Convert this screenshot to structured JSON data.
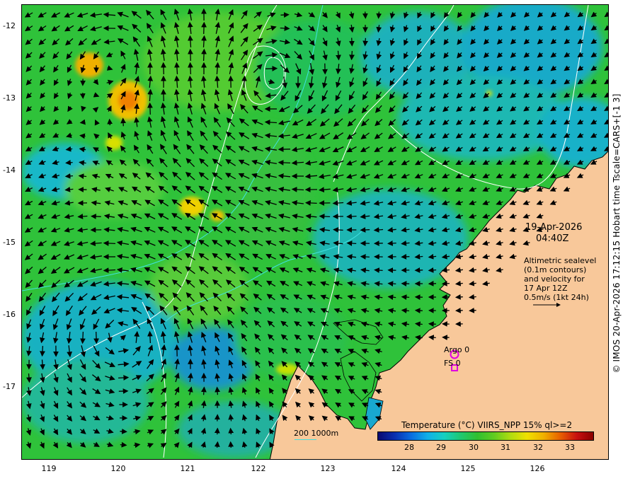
{
  "map": {
    "lat_ticks": [
      "-12",
      "-13",
      "-14",
      "-15",
      "-16",
      "-17"
    ],
    "lon_ticks": [
      "119",
      "120",
      "121",
      "122",
      "123",
      "124",
      "125",
      "126"
    ],
    "date": "19-Apr-2026",
    "time": "04:40Z",
    "info": "Altimetric sealevel\n(0.1m contours)\nand velocity for\n17 Apr 12Z\n0.5m/s (1kt 24h)",
    "credit": "© IMOS 20-Apr-2026 17:12:15 Hobart time Tscale=CARS+[-1 3]",
    "scale_label": "200  1000m",
    "markers": [
      {
        "label": "Argo 0",
        "shape": "circle",
        "color": "#e000e0"
      },
      {
        "label": "FS 0",
        "shape": "square",
        "color": "#e000e0"
      }
    ],
    "colorbar": {
      "title": "Temperature (°C) VIIRS_NPP 15% ql>=2",
      "ticks": [
        "28",
        "29",
        "30",
        "31",
        "32",
        "33"
      ]
    },
    "colors": {
      "land": "#f8c89a",
      "ocean_base": "#2fc23a",
      "contour": "#ffffff",
      "isobath": "#40e0e0",
      "arrow": "#000000"
    }
  }
}
